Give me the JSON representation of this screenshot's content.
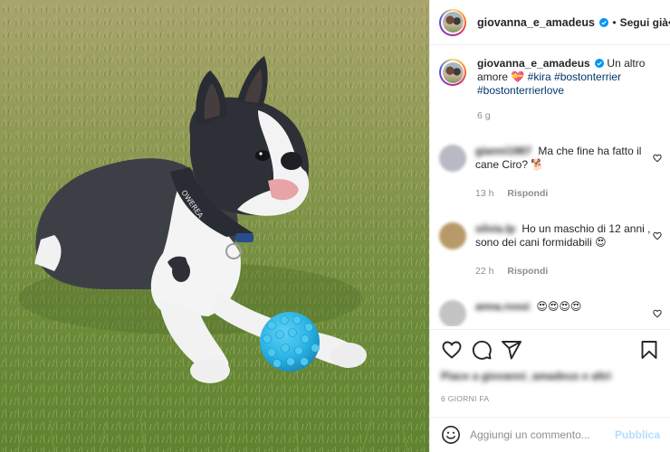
{
  "post": {
    "username": "giovanna_e_amadeus",
    "follow_label": "Segui già",
    "caption": {
      "username": "giovanna_e_amadeus",
      "text": "Un altro amore",
      "emoji": "💝",
      "hashtags": [
        "#kira",
        "#bostonterrier",
        "#bostonterrierlove"
      ],
      "time": "6 g"
    },
    "comments": [
      {
        "username": "gianni1987",
        "text": "Ma che fine ha fatto il cane Ciro?",
        "emoji": "🐕",
        "time": "13 h",
        "reply_label": "Rispondi",
        "avatar_color": "#b7b9c4"
      },
      {
        "username": "silvia.lp",
        "text": "Ho un maschio di 12 anni , sono dei cani formidabili",
        "emoji": "😍",
        "time": "22 h",
        "reply_label": "Rispondi",
        "avatar_color": "#b89a6a"
      },
      {
        "username": "anna.rossi",
        "text": "",
        "emoji": "😍😍😍😍",
        "avatar_color": "#c4c4c4"
      }
    ],
    "likes_text": "Piace a giovanni_amadeus e altri",
    "date": "6 GIORNI FA",
    "add_comment_placeholder": "Aggiungi un commento...",
    "publish_label": "Pubblica"
  },
  "colors": {
    "accent": "#0095f6",
    "publish_disabled": "#b2dffc",
    "hashtag": "#00376b",
    "muted": "#8e8e8e",
    "ball": "#29b4e6"
  },
  "icons": [
    "verified-icon",
    "more-options-icon",
    "heart-icon",
    "comment-icon",
    "share-icon",
    "bookmark-icon",
    "emoji-icon"
  ]
}
